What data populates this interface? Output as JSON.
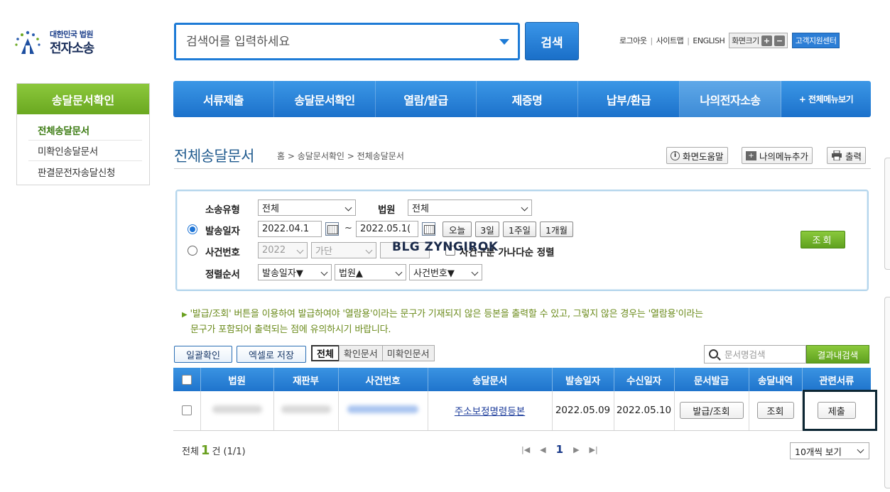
{
  "logo": {
    "line1": "대한민국 법원",
    "line2": "전자소송"
  },
  "search": {
    "placeholder": "검색어를 입력하세요",
    "button": "검색"
  },
  "top_links": {
    "logout": "로그아웃",
    "sitemap": "사이트맵",
    "english": "ENGLISH",
    "font_size": "화면크기",
    "plus": "+",
    "minus": "−",
    "helpdesk": "고객지원센터"
  },
  "nav": [
    "서류제출",
    "송달문서확인",
    "열람/발급",
    "제증명",
    "납부/환급",
    "나의전자소송",
    "+ 전체메뉴보기"
  ],
  "sidebar": {
    "title": "송달문서확인",
    "items": [
      "전체송달문서",
      "미확인송달문서",
      "판결문전자송달신청"
    ]
  },
  "page": {
    "title": "전체송달문서",
    "breadcrumb": "홈 > 송달문서확인 > 전체송달문서",
    "help": "화면도움말",
    "mymenu": "나의메뉴추가",
    "print": "출력"
  },
  "filter": {
    "type_label": "소송유형",
    "type_value": "전체",
    "court_label": "법원",
    "court_value": "전체",
    "date_label": "발송일자",
    "date_from": "2022.04.1",
    "date_to": "2022.05.1(",
    "today": "오늘",
    "d3": "3일",
    "w1": "1주일",
    "m1": "1개월",
    "case_label": "사건번호",
    "case_year": "2022",
    "case_kind": "가단",
    "sort_check": "사건구분 가나다순 정렬",
    "order_label": "정렬순서",
    "order1": "발송일자▼",
    "order2": "법원▲",
    "order3": "사건번호▼",
    "query": "조회",
    "watermark": "BLG ZYNGIROK"
  },
  "notice": {
    "line1": "'발급/조회' 버튼을 이용하여 발급하여야 '열람용'이라는 문구가 기재되지 않은 등본을 출력할 수 있고, 그렇지 않은 경우는 '열람용'이라는",
    "line2": "문구가 포함되어 출력되는 점에 유의하시기 바랍니다."
  },
  "actions": {
    "bulk_confirm": "일괄확인",
    "excel": "엑셀로 저장",
    "tabs": [
      "전체",
      "확인문서",
      "미확인문서"
    ],
    "doc_search_placeholder": "문서명검색",
    "refine": "결과내검색"
  },
  "table": {
    "headers": [
      "법원",
      "재판부",
      "사건번호",
      "송달문서",
      "발송일자",
      "수신일자",
      "문서발급",
      "송달내역",
      "관련서류"
    ],
    "rows": [
      {
        "document": "주소보정명령등본",
        "sent": "2022.05.09",
        "received": "2022.05.10",
        "issue": "발급/조회",
        "history": "조회",
        "related": "제출"
      }
    ]
  },
  "footer": {
    "total_prefix": "전체",
    "count": "1",
    "total_suffix": "건 (1/1)",
    "page": "1",
    "per_page": "10개씩 보기"
  },
  "colors": {
    "nav_blue": "#1c71cb",
    "green": "#6aa820",
    "highlight": "#0c2633"
  }
}
